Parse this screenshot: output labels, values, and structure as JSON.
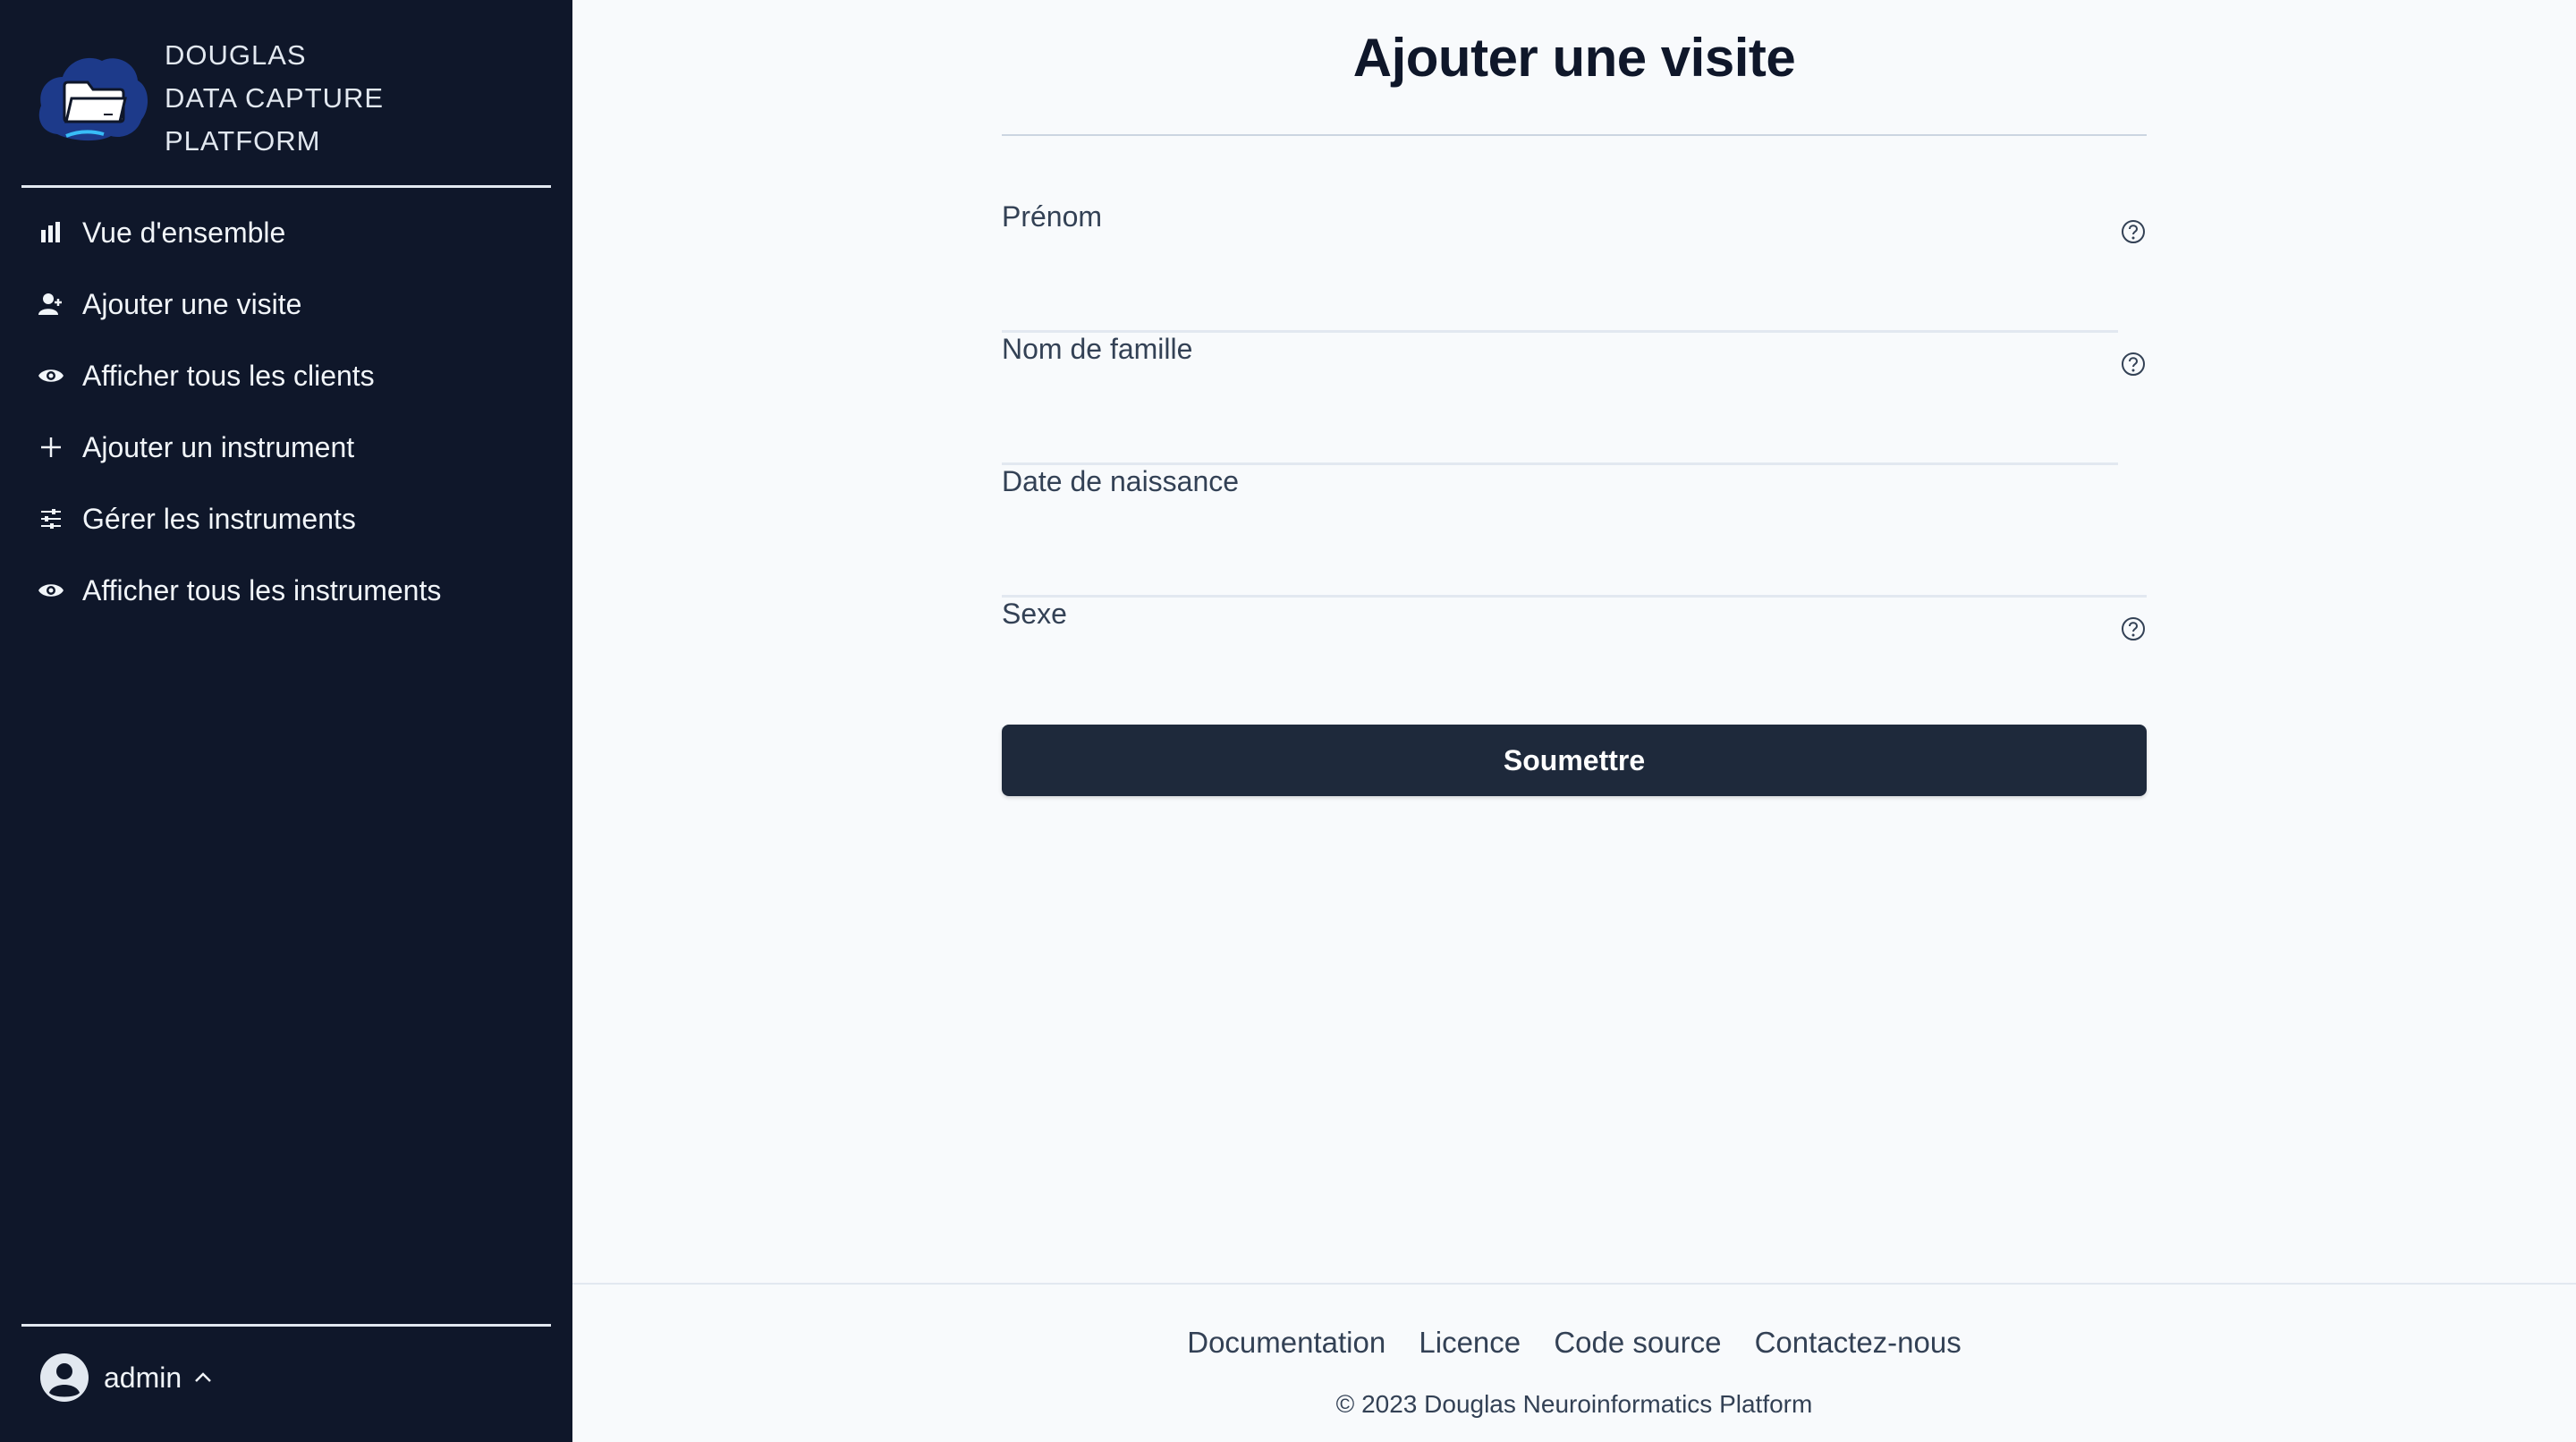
{
  "brand": {
    "line1": "DOUGLAS",
    "line2": "DATA CAPTURE",
    "line3": "PLATFORM",
    "logo_icon": "folder-cloud-logo"
  },
  "sidebar": {
    "items": [
      {
        "label": "Vue d'ensemble",
        "icon": "bar-chart-icon"
      },
      {
        "label": "Ajouter une visite",
        "icon": "user-plus-icon"
      },
      {
        "label": "Afficher tous les clients",
        "icon": "eye-icon"
      },
      {
        "label": "Ajouter un instrument",
        "icon": "plus-icon"
      },
      {
        "label": "Gérer les instruments",
        "icon": "sliders-icon"
      },
      {
        "label": "Afficher tous les instruments",
        "icon": "eye-icon"
      }
    ],
    "user": {
      "name": "admin"
    }
  },
  "main": {
    "title": "Ajouter une visite",
    "fields": [
      {
        "label": "Prénom",
        "help": true
      },
      {
        "label": "Nom de famille",
        "help": true
      },
      {
        "label": "Date de naissance",
        "help": false
      },
      {
        "label": "Sexe",
        "help": true
      }
    ],
    "submit_label": "Soumettre"
  },
  "footer": {
    "links": [
      "Documentation",
      "Licence",
      "Code source",
      "Contactez-nous"
    ],
    "copyright": "© 2023 Douglas Neuroinformatics Platform"
  },
  "colors": {
    "sidebar_bg": "#0f172a",
    "main_bg": "#f8fafc",
    "button_bg": "#1e293b",
    "text_dark": "#0f172a",
    "text_muted": "#334155"
  }
}
